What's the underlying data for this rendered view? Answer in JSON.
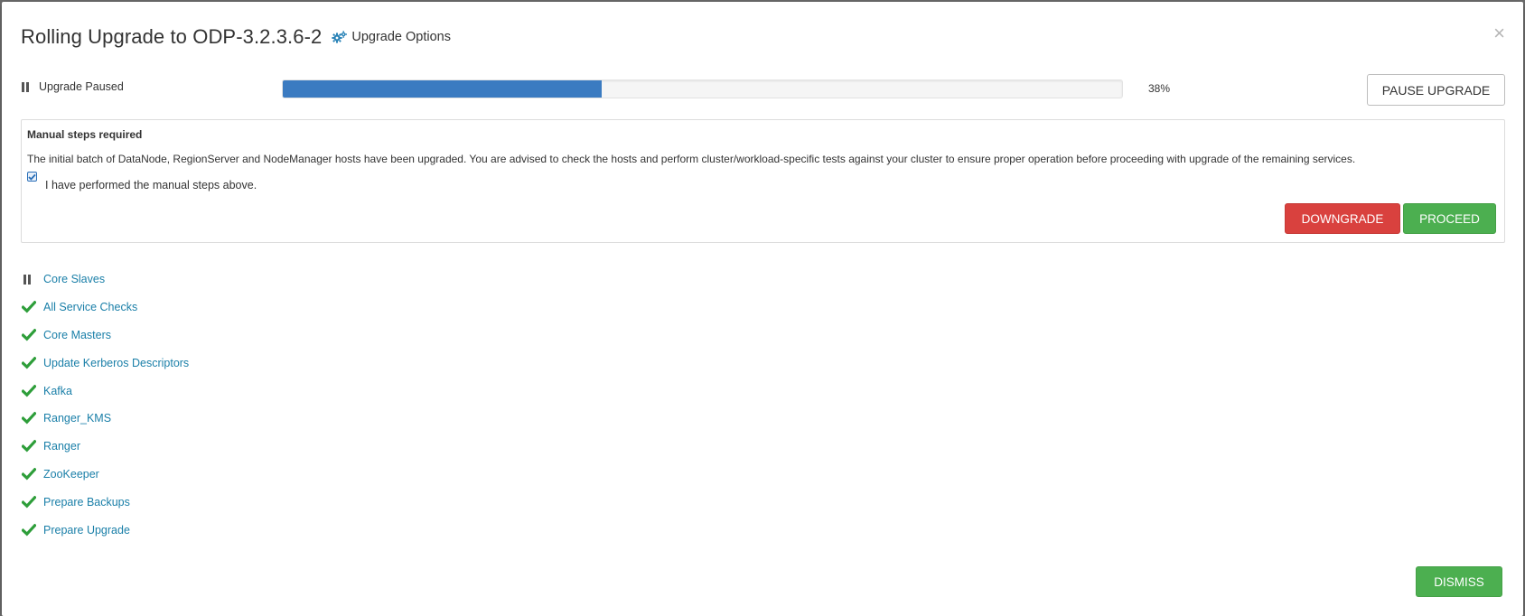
{
  "dialog": {
    "title": "Rolling Upgrade to ODP-3.2.3.6-2",
    "options_label": "Upgrade Options",
    "close_symbol": "×"
  },
  "status": {
    "label": "Upgrade Paused",
    "icon": "pause-icon",
    "progress_percent": 38,
    "progress_text": "38%",
    "progress_color": "#3b7bc1"
  },
  "pause_button": {
    "label": "PAUSE UPGRADE"
  },
  "manual_steps": {
    "title": "Manual steps required",
    "message": "The initial batch of DataNode, RegionServer and NodeManager hosts have been upgraded. You are advised to check the hosts and perform cluster/workload-specific tests against your cluster to ensure proper operation before proceeding with upgrade of the remaining services.",
    "checkbox_label": "I have performed the manual steps above.",
    "checkbox_checked": true,
    "downgrade_label": "DOWNGRADE",
    "proceed_label": "PROCEED",
    "downgrade_color": "#d9413e",
    "proceed_color": "#4caf50"
  },
  "steps": [
    {
      "label": "Core Slaves",
      "status": "paused",
      "icon": "pause-icon"
    },
    {
      "label": "All Service Checks",
      "status": "completed",
      "icon": "check-icon"
    },
    {
      "label": "Core Masters",
      "status": "completed",
      "icon": "check-icon"
    },
    {
      "label": "Update Kerberos Descriptors",
      "status": "completed",
      "icon": "check-icon"
    },
    {
      "label": "Kafka",
      "status": "completed",
      "icon": "check-icon"
    },
    {
      "label": "Ranger_KMS",
      "status": "completed",
      "icon": "check-icon"
    },
    {
      "label": "Ranger",
      "status": "completed",
      "icon": "check-icon"
    },
    {
      "label": "ZooKeeper",
      "status": "completed",
      "icon": "check-icon"
    },
    {
      "label": "Prepare Backups",
      "status": "completed",
      "icon": "check-icon"
    },
    {
      "label": "Prepare Upgrade",
      "status": "completed",
      "icon": "check-icon"
    }
  ],
  "dismiss_button": {
    "label": "DISMISS"
  },
  "colors": {
    "link": "#1a7fa8",
    "check": "#2e9e3a"
  }
}
